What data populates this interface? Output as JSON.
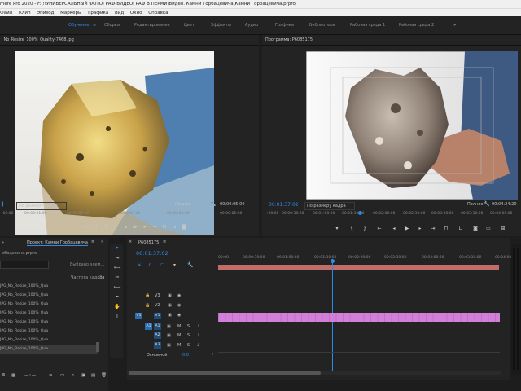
{
  "titlebar": {
    "title": "mere Pro 2020 - F:\\!!УНИВЕРСАЛЬНЫЙ ФОТОГРАФ-ВИДЕОГРАФ В ПЕРМИ\\Видео. Камни Горбацевича\\Камни Горбацевича.prproj"
  },
  "menu": {
    "items": [
      "Файл",
      "Клип",
      "Эпизод",
      "Маркеры",
      "Графика",
      "Вид",
      "Окно",
      "Справка"
    ]
  },
  "workspaces": {
    "items": [
      "Обучение",
      "Сборка",
      "Редактирование",
      "Цвет",
      "Эффекты",
      "Аудио",
      "Графика",
      "Библиотеки",
      "Рабочая среда 1",
      "Рабочая среда 2"
    ],
    "more": "»"
  },
  "source": {
    "tab": "_No_Resize_100%_Quality-7468.jpg",
    "ruler": [
      ":00:00",
      "00:00:01:00",
      "00:00:02:00",
      "00:00:03:00",
      "00:00:04:00",
      "00:00:05:00"
    ],
    "fit": "По размеру кадра",
    "quality": "Полное",
    "duration": "00:00:05:00"
  },
  "program": {
    "tab": "Программа: P6085175",
    "menu_icon": "≡",
    "timecode": "00:01:37:02",
    "fit": "По размеру кадра",
    "quality": "Полное",
    "duration": "00:04:24:20",
    "ruler": [
      ":00:00",
      "00:00:30:00",
      "00:01:00:00",
      "00:01:30:00",
      "00:02:00:00",
      "00:02:30:00",
      "00:03:00:00",
      "00:03:30:00",
      "00:04:00:00"
    ]
  },
  "project": {
    "tab1": "»",
    "tab2": "Проект: Камни Горбацевича",
    "file": "рбацевича.prproj",
    "search_hint": "Выбрано элем...",
    "column": "Частота кадров",
    "column_short": "За",
    "items": [
      "JPG_No_Resize_100%_Qua",
      "JPG_No_Resize_100%_Qua",
      "JPG_No_Resize_100%_Qua",
      "JPG_No_Resize_100%_Qua",
      "JPG_No_Resize_100%_Qua",
      "JPG_No_Resize_100%_Qua",
      "JPG_No_Resize_100%_Qua",
      "JPG_No_Resize_100%_Qua"
    ]
  },
  "timeline": {
    "tab": "P6085175",
    "timecode": "00:01:37:02",
    "ruler": [
      "00:00",
      "00:00:30:00",
      "00:01:00:00",
      "00:01:30:00",
      "00:02:00:00",
      "00:02:30:00",
      "00:03:00:00",
      "00:03:30:00",
      "00:04:00"
    ],
    "tracks": [
      {
        "name": "V3",
        "kind": "video"
      },
      {
        "name": "V2",
        "kind": "video"
      },
      {
        "name": "V1",
        "kind": "video",
        "source": "V1"
      },
      {
        "name": "A1",
        "kind": "audio",
        "source": "A1"
      },
      {
        "name": "A2",
        "kind": "audio"
      },
      {
        "name": "A3",
        "kind": "audio"
      }
    ],
    "master_label": "Основной",
    "master_value": "0.0",
    "btn_m": "M",
    "btn_s": "S",
    "clip_color": "#d27fd8"
  },
  "colors": {
    "accent": "#2d8ceb",
    "clip": "#d27fd8",
    "work_area": "#c06c68"
  }
}
